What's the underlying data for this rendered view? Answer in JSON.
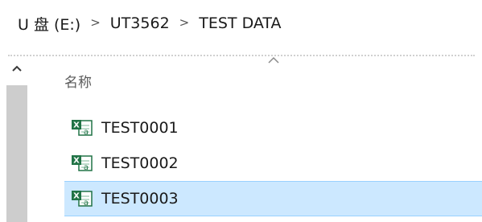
{
  "breadcrumb": {
    "items": [
      "U 盘 (E:)",
      "UT3562",
      "TEST DATA"
    ],
    "separator": ">"
  },
  "list": {
    "column_header": "名称",
    "files": [
      {
        "name": "TEST0001",
        "icon": "excel-csv-file-icon",
        "selected": false
      },
      {
        "name": "TEST0002",
        "icon": "excel-csv-file-icon",
        "selected": false
      },
      {
        "name": "TEST0003",
        "icon": "excel-csv-file-icon",
        "selected": true
      }
    ]
  },
  "colors": {
    "selection_bg": "#cce8ff",
    "selection_border": "#99d1ff",
    "excel_green": "#217346"
  }
}
